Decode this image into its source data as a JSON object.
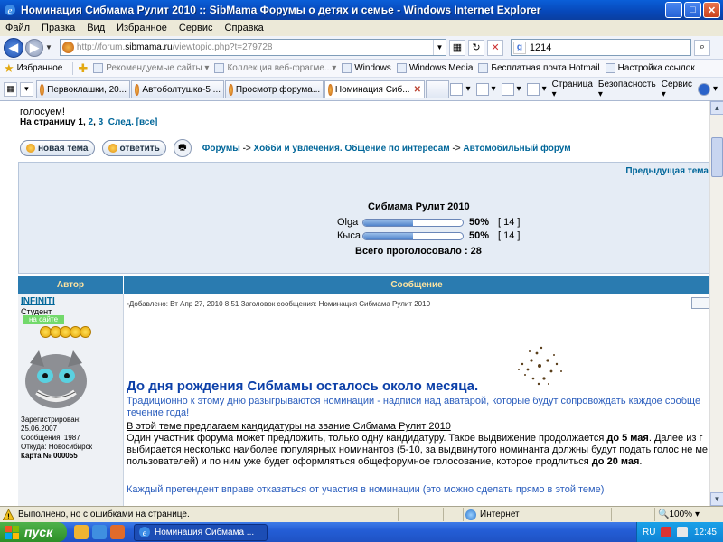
{
  "window": {
    "title": "Номинация Сибмама Рулит 2010 :: SibMama Форумы о детях и семье - Windows Internet Explorer",
    "minimize_glyph": "_",
    "maximize_glyph": "□",
    "close_glyph": "✕"
  },
  "menu": [
    "Файл",
    "Правка",
    "Вид",
    "Избранное",
    "Сервис",
    "Справка"
  ],
  "address": {
    "prefix": "http://forum.",
    "host": "sibmama.ru",
    "path": "/viewtopic.php?t=279728",
    "search_value": "1214"
  },
  "favorites_bar": {
    "label": "Избранное",
    "items": [
      {
        "label": "Рекомендуемые сайты ▾",
        "dim": true
      },
      {
        "label": "Коллекция веб-фрагме...▾",
        "dim": true
      },
      {
        "label": "Windows",
        "dim": false
      },
      {
        "label": "Windows Media",
        "dim": false
      },
      {
        "label": "Бесплатная почта Hotmail",
        "dim": false
      },
      {
        "label": "Настройка ссылок",
        "dim": false
      }
    ]
  },
  "tabs": [
    {
      "label": "Первоклашки, 20...",
      "active": false
    },
    {
      "label": "Автоболтушка-5 ...",
      "active": false
    },
    {
      "label": "Просмотр форума...",
      "active": false
    },
    {
      "label": "Номинация Сиб...",
      "active": true
    }
  ],
  "tab_close": "✕",
  "tools": [
    "Страница ▾",
    "Безопасность ▾",
    "Сервис ▾"
  ],
  "page": {
    "line1": "голосуем!",
    "pager_prefix": "На страницу ",
    "pager_current": "1",
    "pager_sep1": ", ",
    "pager_p2": "2",
    "pager_sep2": ", ",
    "pager_p3": "3",
    "pager_next": "След.",
    "pager_all": "[все]",
    "new_topic": "новая тема",
    "reply": "ответить",
    "crumb1": "Форумы",
    "crumb2": "Хобби и увлечения. Общение по интересам",
    "crumb3": "Автомобильный форум",
    "crumb_arrow": "->",
    "prev_topic": "Предыдущая тема"
  },
  "poll": {
    "title": "Сибмама Рулит 2010",
    "options": [
      {
        "name": "Olga",
        "percent": 50,
        "percent_label": "50%",
        "votes": "[ 14 ]"
      },
      {
        "name": "Кыса",
        "percent": 50,
        "percent_label": "50%",
        "votes": "[ 14 ]"
      }
    ],
    "total": "Всего проголосовало : 28"
  },
  "table": {
    "col_author": "Автор",
    "col_message": "Сообщение"
  },
  "author": {
    "nick": "INFINITI",
    "rank": "Студент",
    "online": "на сайте",
    "registered_label": "Зарегистрирован:",
    "registered_value": "25.06.2007",
    "posts": "Сообщения: 1987",
    "from": "Откуда: Новосибирск",
    "card": "Карта № 000055"
  },
  "post": {
    "header": "Добавлено: Вт Апр 27, 2010 8:51    Заголовок сообщения: Номинация Сибмама Рулит 2010",
    "heading": "До дня рождения Сибмамы осталось около месяца.",
    "p1": "Традиционно к этому дню разыгрываются номинации - надписи над аватарой, которые будут сопровождать каждое сообще течение года!",
    "p2": "В этой теме предлагаем кандидатуры на звание Сибмама Рулит 2010",
    "p3_a": "Один участник форума может предложить, только одну кандидатуру. Такое выдвижение продолжается ",
    "p3_b": "до 5 мая",
    "p3_c": ". Далее из г выбирается несколько наиболее популярных номинантов (5-10, за выдвинутого номинанта должны будут подать голос не ме пользователей) и по ним уже будет оформляться общефорумное голосование, которое продлиться ",
    "p3_d": "до 20 мая",
    "p3_e": ".",
    "p4": "Каждый претендент вправе отказаться от участия в номинации (это можно сделать прямо в этой теме)"
  },
  "status": {
    "text": "Выполнено, но с ошибками на странице.",
    "zone": "Интернет",
    "zoom": "100%"
  },
  "taskbar": {
    "start": "пуск",
    "item": "Номинация Сибмама ...",
    "lang": "RU",
    "clock": "12:45"
  }
}
